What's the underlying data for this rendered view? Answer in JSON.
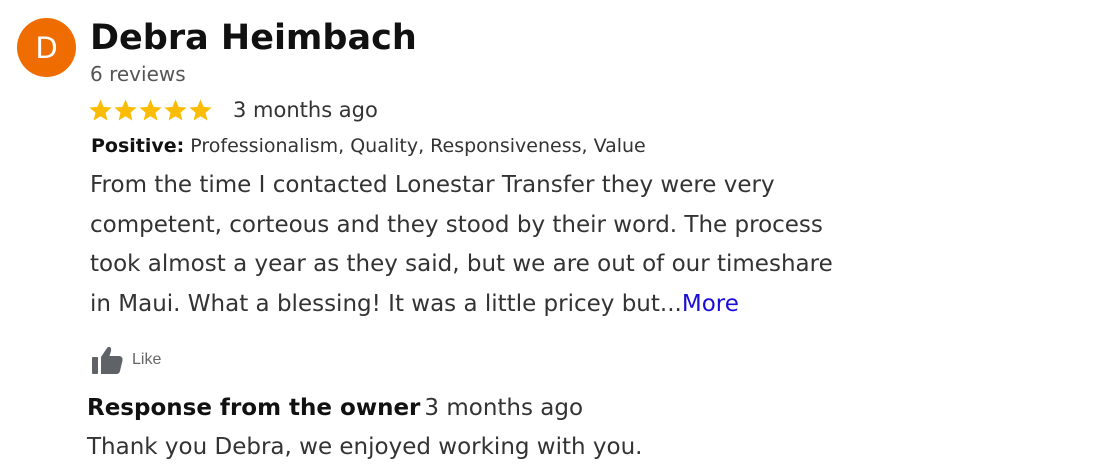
{
  "reviewer": {
    "avatar_letter": "D",
    "avatar_color": "#ef6c00",
    "name": "Debra Heimbach",
    "review_count": "6 reviews"
  },
  "review": {
    "rating": 5,
    "rating_max": 5,
    "star_color": "#fbbc04",
    "time": "3 months ago",
    "positive_label": "Positive:",
    "positive_values": "Professionalism, Quality, Responsiveness, Value",
    "text_lines": [
      "From the time I contacted Lonestar Transfer they were very",
      "competent, corteous and they stood by their word. The process",
      "took almost a year as they said, but we are out of our timeshare",
      "in Maui. What a blessing! It was a little pricey but..."
    ],
    "more_label": "More",
    "more_color": "#1a0dd8"
  },
  "actions": {
    "like_icon": "thumbs-up-icon",
    "like_label": "Like"
  },
  "owner_response": {
    "title": "Response from the owner",
    "time": "3 months ago",
    "text": "Thank you Debra, we enjoyed working with you."
  }
}
